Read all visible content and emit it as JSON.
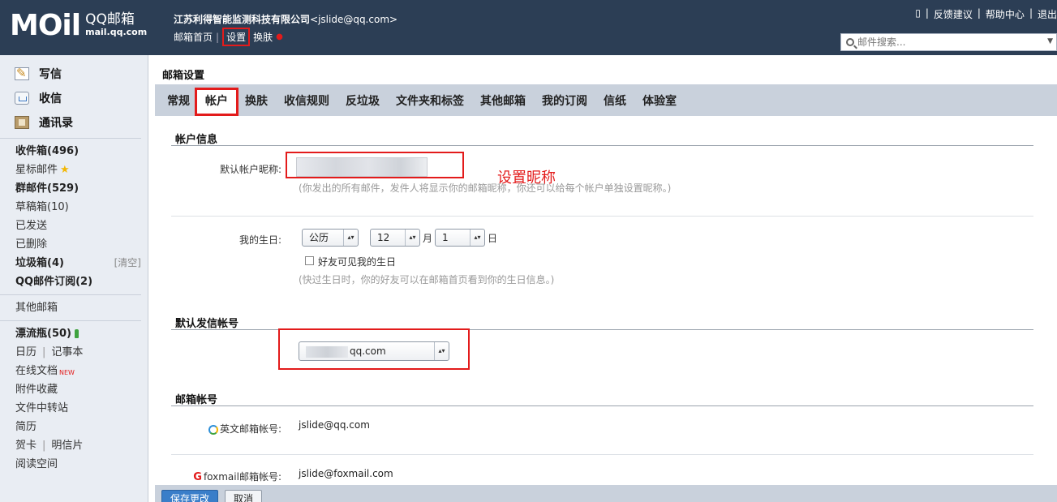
{
  "header": {
    "logo_main": "MOil",
    "logo_cn": "QQ邮箱",
    "logo_domain": "mail.qq.com",
    "account_name": "江苏利得智能监测科技有限公司",
    "account_email": "<jslide@qq.com>",
    "nav": {
      "home": "邮箱首页",
      "settings": "设置",
      "skin": "换肤"
    },
    "links": {
      "feedback": "反馈建议",
      "help": "帮助中心",
      "logout": "退出"
    },
    "search": {
      "placeholder": "邮件搜索..."
    }
  },
  "sidebar": {
    "top": [
      {
        "label": "写信",
        "icon": "pen-icon"
      },
      {
        "label": "收信",
        "icon": "inbox-icon"
      },
      {
        "label": "通讯录",
        "icon": "contacts-icon"
      }
    ],
    "folders": {
      "inbox": "收件箱(496)",
      "starred": "星标邮件",
      "group": "群邮件(529)",
      "drafts": "草稿箱(10)",
      "sent": "已发送",
      "deleted": "已删除",
      "spam": "垃圾箱(4)",
      "spam_clear": "[清空]",
      "subscription": "QQ邮件订阅(2)"
    },
    "other_mailbox": "其他邮箱",
    "tools": {
      "bottle": "漂流瓶(50)",
      "calendar": "日历",
      "notes": "记事本",
      "docs": "在线文档",
      "docs_badge": "NEW",
      "attach": "附件收藏",
      "transfer": "文件中转站",
      "resume": "简历",
      "card": "贺卡",
      "postcard": "明信片",
      "reading": "阅读空间"
    }
  },
  "main": {
    "title": "邮箱设置",
    "tabs": [
      "常规",
      "帐户",
      "换肤",
      "收信规则",
      "反垃圾",
      "文件夹和标签",
      "其他邮箱",
      "我的订阅",
      "信纸",
      "体验室"
    ],
    "active_tab": "帐户",
    "account_info": {
      "section": "帐户信息",
      "nickname_label": "默认帐户昵称:",
      "nickname_hint": "(你发出的所有邮件，发件人将显示你的邮箱昵称，你还可以给每个帐户单独设置昵称。)",
      "annotation": "设置昵称",
      "birthday_label": "我的生日:",
      "calendar_type": "公历",
      "month": "12",
      "month_unit": "月",
      "day": "1",
      "day_unit": "日",
      "birthday_visible_label": "好友可见我的生日",
      "birthday_hint": "(快过生日时，你的好友可以在邮箱首页看到你的生日信息。)"
    },
    "default_sender": {
      "section": "默认发信帐号",
      "value": "qq.com"
    },
    "mail_accounts": {
      "section": "邮箱帐号",
      "english_label": "英文邮箱帐号:",
      "english_value": "jslide@qq.com",
      "foxmail_label": "foxmail邮箱帐号:",
      "foxmail_value": "jslide@foxmail.com"
    },
    "buttons": {
      "save": "保存更改",
      "cancel": "取消"
    }
  }
}
